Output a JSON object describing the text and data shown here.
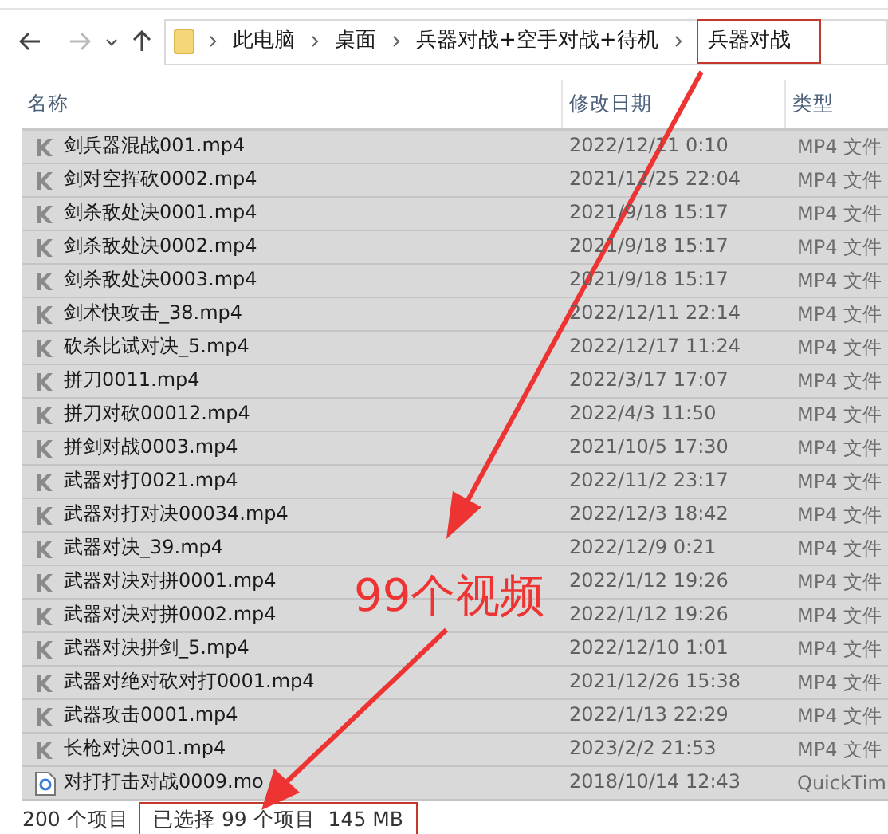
{
  "breadcrumb": [
    {
      "label": "此电脑",
      "outlined": false
    },
    {
      "label": "桌面",
      "outlined": false
    },
    {
      "label": "兵器对战+空手对战+待机",
      "outlined": false
    },
    {
      "label": "兵器对战",
      "outlined": true
    }
  ],
  "columns": [
    "名称",
    "修改日期",
    "类型"
  ],
  "files": [
    {
      "name": "剑兵器混战001.mp4",
      "date": "2022/12/11 0:10",
      "type": "MP4 文件",
      "kind": "video",
      "selected": true
    },
    {
      "name": "剑对空挥砍0002.mp4",
      "date": "2021/12/25 22:04",
      "type": "MP4 文件",
      "kind": "video",
      "selected": true
    },
    {
      "name": "剑杀敌处决0001.mp4",
      "date": "2021/9/18 15:17",
      "type": "MP4 文件",
      "kind": "video",
      "selected": true
    },
    {
      "name": "剑杀敌处决0002.mp4",
      "date": "2021/9/18 15:17",
      "type": "MP4 文件",
      "kind": "video",
      "selected": true
    },
    {
      "name": "剑杀敌处决0003.mp4",
      "date": "2021/9/18 15:17",
      "type": "MP4 文件",
      "kind": "video",
      "selected": true
    },
    {
      "name": "剑术快攻击_38.mp4",
      "date": "2022/12/11 22:14",
      "type": "MP4 文件",
      "kind": "video",
      "selected": true
    },
    {
      "name": "砍杀比试对决_5.mp4",
      "date": "2022/12/17 11:24",
      "type": "MP4 文件",
      "kind": "video",
      "selected": true
    },
    {
      "name": "拼刀0011.mp4",
      "date": "2022/3/17 17:07",
      "type": "MP4 文件",
      "kind": "video",
      "selected": true
    },
    {
      "name": "拼刀对砍00012.mp4",
      "date": "2022/4/3 11:50",
      "type": "MP4 文件",
      "kind": "video",
      "selected": true
    },
    {
      "name": "拼剑对战0003.mp4",
      "date": "2021/10/5 17:30",
      "type": "MP4 文件",
      "kind": "video",
      "selected": true
    },
    {
      "name": "武器对打0021.mp4",
      "date": "2022/11/2 23:17",
      "type": "MP4 文件",
      "kind": "video",
      "selected": true
    },
    {
      "name": "武器对打对决00034.mp4",
      "date": "2022/12/3 18:42",
      "type": "MP4 文件",
      "kind": "video",
      "selected": true
    },
    {
      "name": "武器对决_39.mp4",
      "date": "2022/12/9 0:21",
      "type": "MP4 文件",
      "kind": "video",
      "selected": true
    },
    {
      "name": "武器对决对拼0001.mp4",
      "date": "2022/1/12 19:26",
      "type": "MP4 文件",
      "kind": "video",
      "selected": true
    },
    {
      "name": "武器对决对拼0002.mp4",
      "date": "2022/1/12 19:26",
      "type": "MP4 文件",
      "kind": "video",
      "selected": true
    },
    {
      "name": "武器对决拼剑_5.mp4",
      "date": "2022/12/10 1:01",
      "type": "MP4 文件",
      "kind": "video",
      "selected": true
    },
    {
      "name": "武器对绝对砍对打0001.mp4",
      "date": "2021/12/26 15:38",
      "type": "MP4 文件",
      "kind": "video",
      "selected": true
    },
    {
      "name": "武器攻击0001.mp4",
      "date": "2022/1/13 22:29",
      "type": "MP4 文件",
      "kind": "video",
      "selected": true
    },
    {
      "name": "长枪对决001.mp4",
      "date": "2023/2/2 21:53",
      "type": "MP4 文件",
      "kind": "video",
      "selected": true
    },
    {
      "name": "对打打击对战0009.mo",
      "date": "2018/10/14 12:43",
      "type": "QuickTim",
      "kind": "quicktime",
      "selected": true
    }
  ],
  "status_bar": {
    "count": "200 个项目",
    "selection": "已选择 99 个项目  145 MB",
    "outlined": true
  },
  "annotation": {
    "label": "99个视频"
  }
}
